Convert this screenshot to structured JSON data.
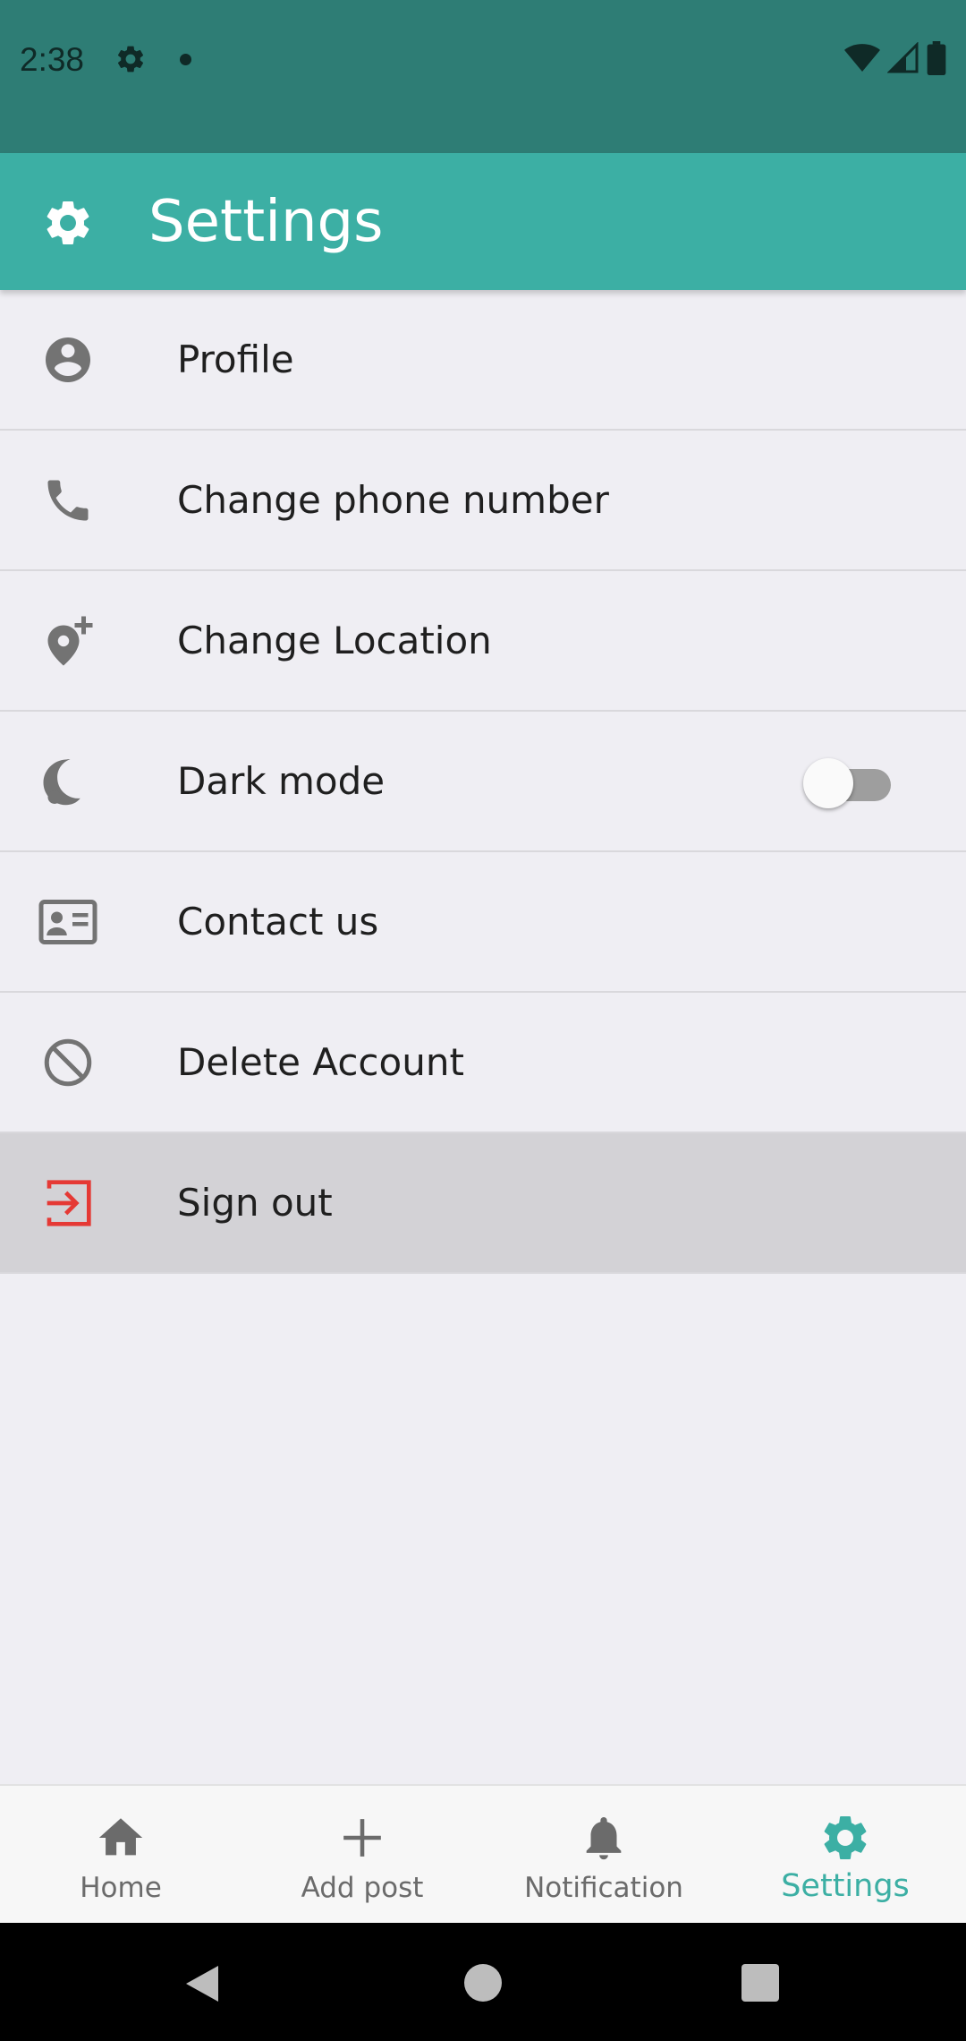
{
  "status_bar": {
    "time": "2:38",
    "icons": [
      "settings-icon",
      "notification-dot",
      "wifi-icon",
      "signal-icon",
      "battery-icon"
    ]
  },
  "app_bar": {
    "title": "Settings",
    "icon": "gear-icon",
    "background_color": "#3cafa4"
  },
  "menu": {
    "items": [
      {
        "label": "Profile",
        "icon": "account-circle-icon"
      },
      {
        "label": "Change phone number",
        "icon": "phone-icon"
      },
      {
        "label": "Change Location",
        "icon": "add-location-icon"
      },
      {
        "label": "Dark mode",
        "icon": "moon-icon",
        "toggle_on": false
      },
      {
        "label": "Contact us",
        "icon": "contact-card-icon"
      },
      {
        "label": "Delete Account",
        "icon": "block-icon"
      },
      {
        "label": "Sign out",
        "icon": "exit-icon",
        "icon_color": "#e53935",
        "highlighted": true
      }
    ]
  },
  "bottom_nav": {
    "items": [
      {
        "label": "Home",
        "icon": "home-icon"
      },
      {
        "label": "Add post",
        "icon": "plus-icon"
      },
      {
        "label": "Notification",
        "icon": "bell-icon"
      },
      {
        "label": "Settings",
        "icon": "gear-icon",
        "active": true
      }
    ],
    "active_color": "#3cafa4"
  },
  "system_nav": {
    "buttons": [
      "back-icon",
      "home-circle-icon",
      "recents-square-icon"
    ]
  }
}
